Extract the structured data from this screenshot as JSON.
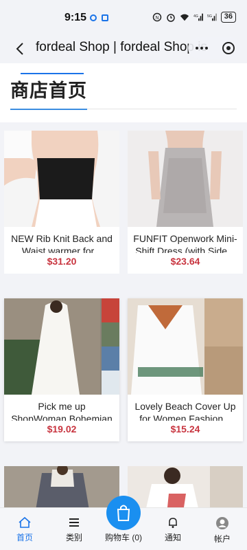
{
  "status_bar": {
    "time": "9:15",
    "battery": "36"
  },
  "nav": {
    "title": "fordeal Shop | fordeal Shop is"
  },
  "header": {
    "title": "商店首页"
  },
  "products": [
    {
      "name": "NEW Rib Knit Back and Waist warmer for...",
      "price": "$31.20"
    },
    {
      "name": "FUNFIT Openwork Mini-Shift Dress (with Side...",
      "price": "$23.64"
    },
    {
      "name": "Pick me up ShopWoman Bohemian Boho...",
      "price": "$19.02"
    },
    {
      "name": "Lovely Beach Cover Up for Women Fashion...",
      "price": "$15.24"
    }
  ],
  "tab_bar": {
    "home": "首页",
    "category": "类别",
    "cart": "购物车 (0)",
    "notify": "通知",
    "account": "帐户"
  },
  "colors": {
    "accent": "#1a73e8",
    "price": "#c8343f",
    "cart_button": "#1a8ff0"
  }
}
